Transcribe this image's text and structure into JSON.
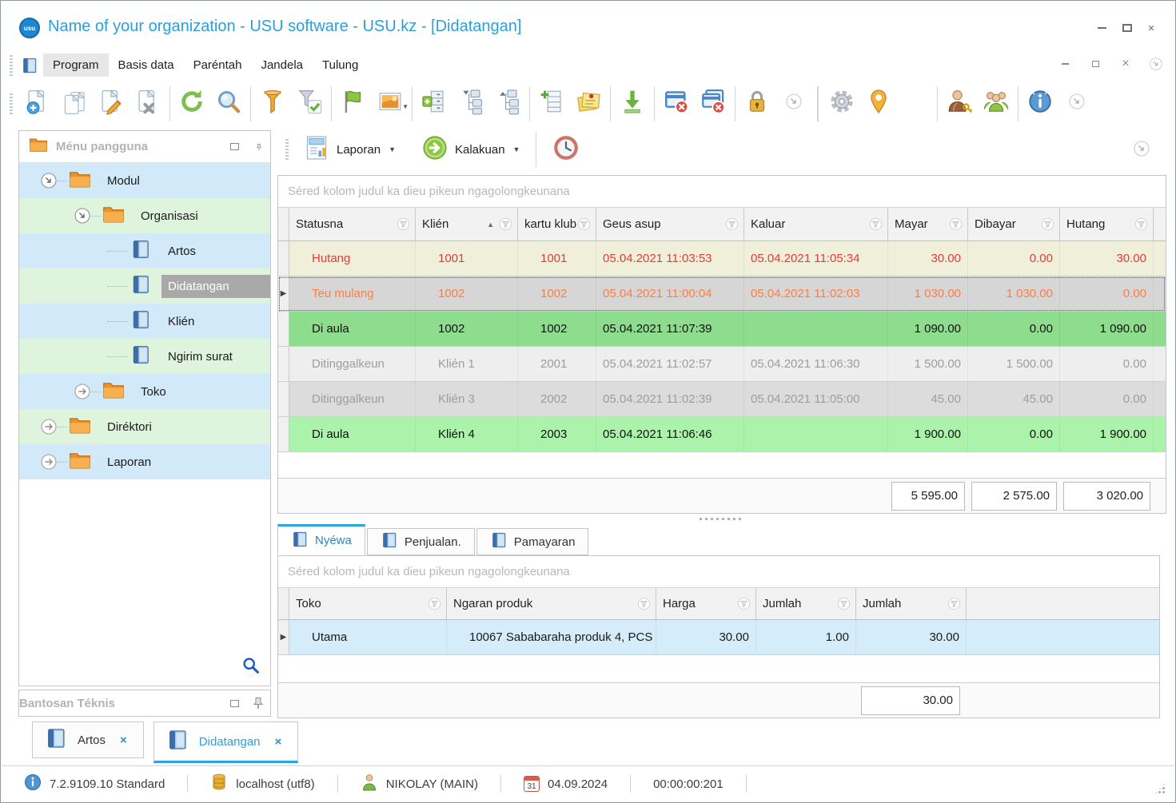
{
  "window": {
    "title": "Name of your organization - USU software - USU.kz - [Didatangan]",
    "close_glyph": "×"
  },
  "menu": {
    "items": [
      "Program",
      "Basis data",
      "Paréntah",
      "Jandela",
      "Tulung"
    ]
  },
  "toolbar": {
    "items": [
      "new-record",
      "copy-record",
      "edit-record",
      "delete-record",
      "sep",
      "refresh",
      "search",
      "sep",
      "filter",
      "filter-apply",
      "sep",
      "flag",
      "image",
      "sep",
      "add-list",
      "collapse-tree",
      "expand-tree",
      "sep",
      "add-row",
      "notes",
      "sep",
      "download",
      "sep",
      "close-window",
      "close-all-windows",
      "sep",
      "lock",
      "chevron",
      "sep2",
      "settings",
      "location",
      "appearance",
      "sep",
      "user-permissions",
      "users",
      "sep",
      "about-info",
      "chevron"
    ]
  },
  "toolbar2": {
    "report_label": "Laporan",
    "action_label": "Kalakuan"
  },
  "sidebar": {
    "header": "Ménu pangguna",
    "tree": [
      {
        "label": "Modul",
        "type": "folder",
        "level": 0,
        "state": "expanded"
      },
      {
        "label": "Organisasi",
        "type": "folder",
        "level": 1,
        "state": "expanded"
      },
      {
        "label": "Artos",
        "type": "module",
        "level": 2
      },
      {
        "label": "Didatangan",
        "type": "module",
        "level": 2,
        "selected": true
      },
      {
        "label": "Klién",
        "type": "module",
        "level": 2
      },
      {
        "label": "Ngirim surat",
        "type": "module",
        "level": 2
      },
      {
        "label": "Toko",
        "type": "folder",
        "level": 1,
        "state": "collapsed"
      },
      {
        "label": "Diréktori",
        "type": "folder",
        "level": 0,
        "state": "collapsed"
      },
      {
        "label": "Laporan",
        "type": "folder",
        "level": 0,
        "state": "collapsed"
      }
    ],
    "support_panel": "Bantosan Téknis"
  },
  "main_table": {
    "group_hint": "Séred kolom judul ka dieu pikeun ngagolongkeunana",
    "columns": [
      "Statusna",
      "Klién",
      "kartu klub",
      "Geus asup",
      "Kaluar",
      "Mayar",
      "Dibayar",
      "Hutang"
    ],
    "sorted_column": "Klién",
    "rows": [
      {
        "style": "debt",
        "marker": false,
        "cells": [
          "Hutang",
          "1001",
          "1001",
          "05.04.2021 11:03:53",
          "05.04.2021 11:05:34",
          "30.00",
          "0.00",
          "30.00"
        ]
      },
      {
        "style": "selected",
        "marker": true,
        "cells": [
          "Teu mulang",
          "1002",
          "1002",
          "05.04.2021 11:00:04",
          "05.04.2021 11:02:03",
          "1 030.00",
          "1 030.00",
          "0.00"
        ]
      },
      {
        "style": "green",
        "marker": false,
        "cells": [
          "Di aula",
          "1002",
          "1002",
          "05.04.2021 11:07:39",
          "",
          "1 090.00",
          "0.00",
          "1 090.00"
        ]
      },
      {
        "style": "gray1",
        "marker": false,
        "cells": [
          "Ditinggalkeun",
          "Klién 1",
          "2001",
          "05.04.2021 11:02:57",
          "05.04.2021 11:06:30",
          "1 500.00",
          "1 500.00",
          "0.00"
        ]
      },
      {
        "style": "gray2",
        "marker": false,
        "cells": [
          "Ditinggalkeun",
          "Klién 3",
          "2002",
          "05.04.2021 11:02:39",
          "05.04.2021 11:05:00",
          "45.00",
          "45.00",
          "0.00"
        ]
      },
      {
        "style": "green2",
        "marker": false,
        "cells": [
          "Di aula",
          "Klién 4",
          "2003",
          "05.04.2021 11:06:46",
          "",
          "1 900.00",
          "0.00",
          "1 900.00"
        ]
      }
    ],
    "totals": [
      "5 595.00",
      "2 575.00",
      "3 020.00"
    ]
  },
  "detail_tabs": [
    {
      "label": "Nyéwa",
      "active": true
    },
    {
      "label": "Penjualan.",
      "active": false
    },
    {
      "label": "Pamayaran",
      "active": false
    }
  ],
  "detail_table": {
    "group_hint": "Séred kolom judul ka dieu pikeun ngagolongkeunana",
    "columns": [
      "Toko",
      "Ngaran produk",
      "Harga",
      "Jumlah",
      "Jumlah"
    ],
    "rows": [
      {
        "style": "detail",
        "marker": true,
        "cells": [
          "Utama",
          "10067 Sababaraha produk 4, PCS",
          "30.00",
          "1.00",
          "30.00"
        ]
      }
    ],
    "total": "30.00"
  },
  "window_tabs": [
    {
      "label": "Artos",
      "active": false
    },
    {
      "label": "Didatangan",
      "active": true
    }
  ],
  "status_bar": {
    "version": "7.2.9109.10 Standard",
    "database": "localhost (utf8)",
    "user": "NIKOLAY (MAIN)",
    "calendar_day": "31",
    "date": "04.09.2024",
    "timer": "00:00:00:201"
  },
  "colors": {
    "accent_blue": "#2a9fdc",
    "row_debt_bg": "#efefda",
    "row_debt_text": "#e43b3b",
    "row_selected_bg": "#d6d6d6",
    "row_selected_text": "#ff7d45",
    "row_inhall_bg": "#8edc8e",
    "row_inhall_light_bg": "#abf3ab",
    "row_left_text": "#9d9d9d",
    "tree_row_blue": "#d2e9fa",
    "tree_row_green": "#def4dd",
    "tree_selected_bg": "#a9a9a9"
  }
}
